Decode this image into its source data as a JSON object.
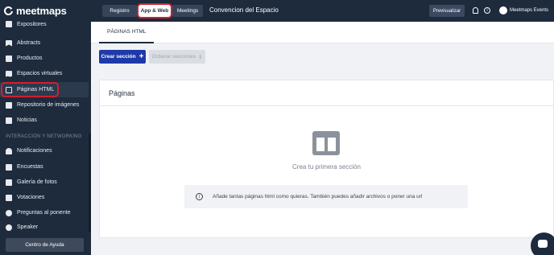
{
  "logo": {
    "text": "meetmaps"
  },
  "sidebar": {
    "items": [
      {
        "label": "Expositores",
        "icon": "grid-icon"
      },
      {
        "label": "Abstracts",
        "icon": "book-icon"
      },
      {
        "label": "Productos",
        "icon": "box-icon"
      },
      {
        "label": "Espacios virtuales",
        "icon": "map-icon"
      },
      {
        "label": "Páginas HTML",
        "icon": "html-page-icon"
      },
      {
        "label": "Repositorio de imágenes",
        "icon": "image-icon"
      },
      {
        "label": "Noticias",
        "icon": "news-icon"
      }
    ],
    "section_label": "INTERACCIÓN Y NETWORKING",
    "items2": [
      {
        "label": "Notificaciones",
        "icon": "bell-icon"
      },
      {
        "label": "Encuestas",
        "icon": "survey-icon"
      },
      {
        "label": "Galería de fotos",
        "icon": "photo-icon"
      },
      {
        "label": "Votaciones",
        "icon": "vote-icon"
      },
      {
        "label": "Preguntas al ponente",
        "icon": "question-icon"
      },
      {
        "label": "Speaker",
        "icon": "user-icon"
      }
    ],
    "help_label": "Centro de Ayuda"
  },
  "topbar": {
    "tabs": [
      {
        "label": "Registro"
      },
      {
        "label": "App & Web"
      },
      {
        "label": "Meetings"
      }
    ],
    "event_title": "Convencion del Espacio",
    "preview_label": "Previsualizar",
    "user_name": "Meetmaps Events"
  },
  "content": {
    "subtab": "PÁGINAS HTML",
    "create_label": "Crear sección",
    "order_label": "Ordenar secciones",
    "card_title": "Páginas",
    "empty_title": "Crea tu primera sección",
    "info_text": "Añade tantas páginas html como quieras. También puedes añadir archivos o poner una url"
  },
  "colors": {
    "sidebar_bg": "#1e2b3d",
    "accent_blue": "#1f3aa8",
    "highlight_red": "#d0202f"
  }
}
